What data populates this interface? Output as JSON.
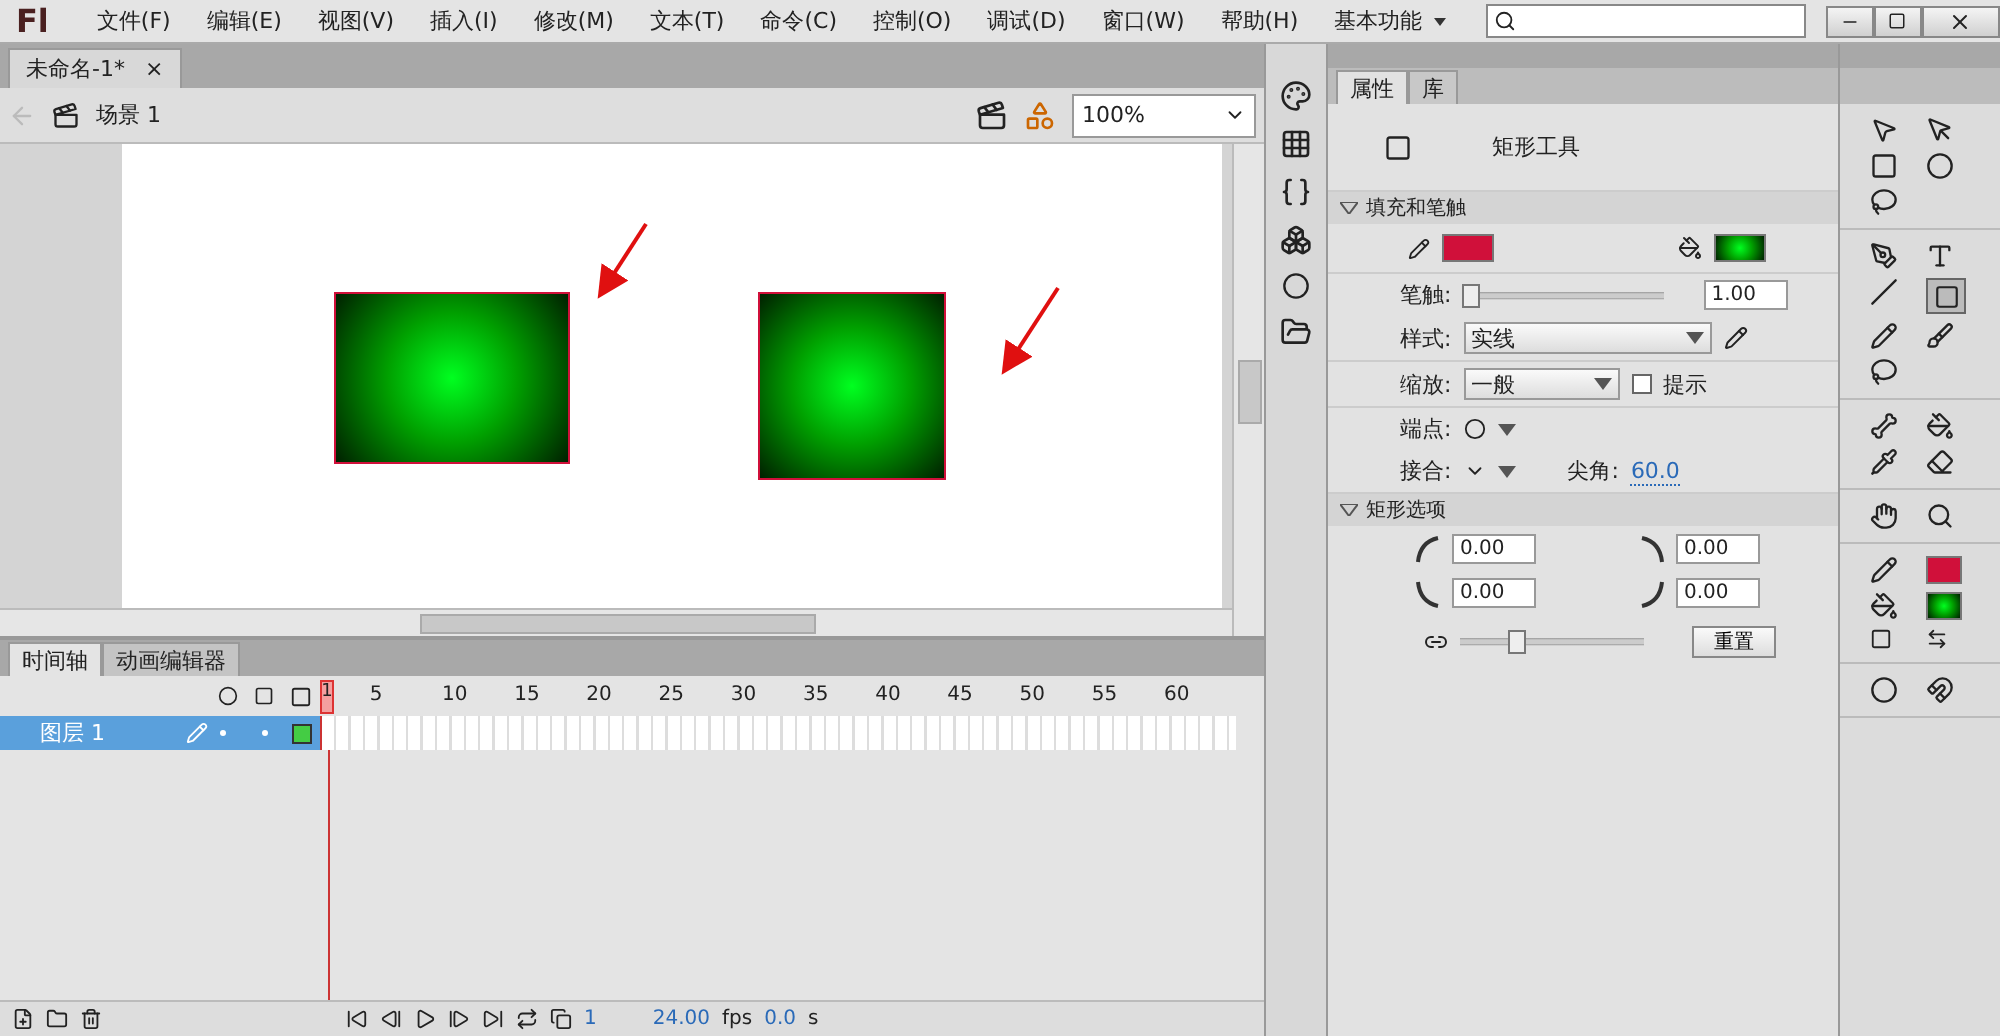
{
  "app": {
    "logo": "Fl"
  },
  "menu": [
    "文件(F)",
    "编辑(E)",
    "视图(V)",
    "插入(I)",
    "修改(M)",
    "文本(T)",
    "命令(C)",
    "控制(O)",
    "调试(D)",
    "窗口(W)",
    "帮助(H)"
  ],
  "workspace": {
    "label": "基本功能"
  },
  "document_tab": {
    "title": "未命名-1*",
    "close": "×"
  },
  "scene": {
    "label": "场景 1"
  },
  "zoom": {
    "value": "100%"
  },
  "properties": {
    "tabs": [
      {
        "label": "属性",
        "selected": true
      },
      {
        "label": "库",
        "selected": false
      }
    ],
    "tool_name": "矩形工具",
    "fill_stroke": {
      "title": "填充和笔触",
      "expanded": true
    },
    "stroke": {
      "label": "笔触:",
      "level": 0.0,
      "value": "1.00"
    },
    "style": {
      "label": "样式:",
      "value": "实线"
    },
    "scale": {
      "label": "缩放:",
      "value": "一般",
      "hint_label": "提示",
      "hint_checked": false
    },
    "cap": {
      "label": "端点:"
    },
    "join": {
      "label": "接合:"
    },
    "miter": {
      "label": "尖角:",
      "value": "60.0"
    },
    "rect_options": {
      "title": "矩形选项",
      "expanded": true,
      "corners": [
        "0.00",
        "0.00",
        "0.00",
        "0.00"
      ],
      "level": 0.3,
      "reset": "重置"
    }
  },
  "timeline": {
    "tabs": [
      {
        "label": "时间轴",
        "selected": true
      },
      {
        "label": "动画编辑器",
        "selected": false
      }
    ],
    "frame_numbers": [
      "1",
      "5",
      "10",
      "15",
      "20",
      "25",
      "30",
      "35",
      "40",
      "45",
      "50",
      "55",
      "60"
    ],
    "layers": [
      {
        "name": "图层 1",
        "selected": true
      }
    ],
    "status": {
      "frame": "1",
      "fps_value": "24.00",
      "fps_unit": "fps",
      "time_value": "0.0",
      "time_unit": "s"
    }
  }
}
